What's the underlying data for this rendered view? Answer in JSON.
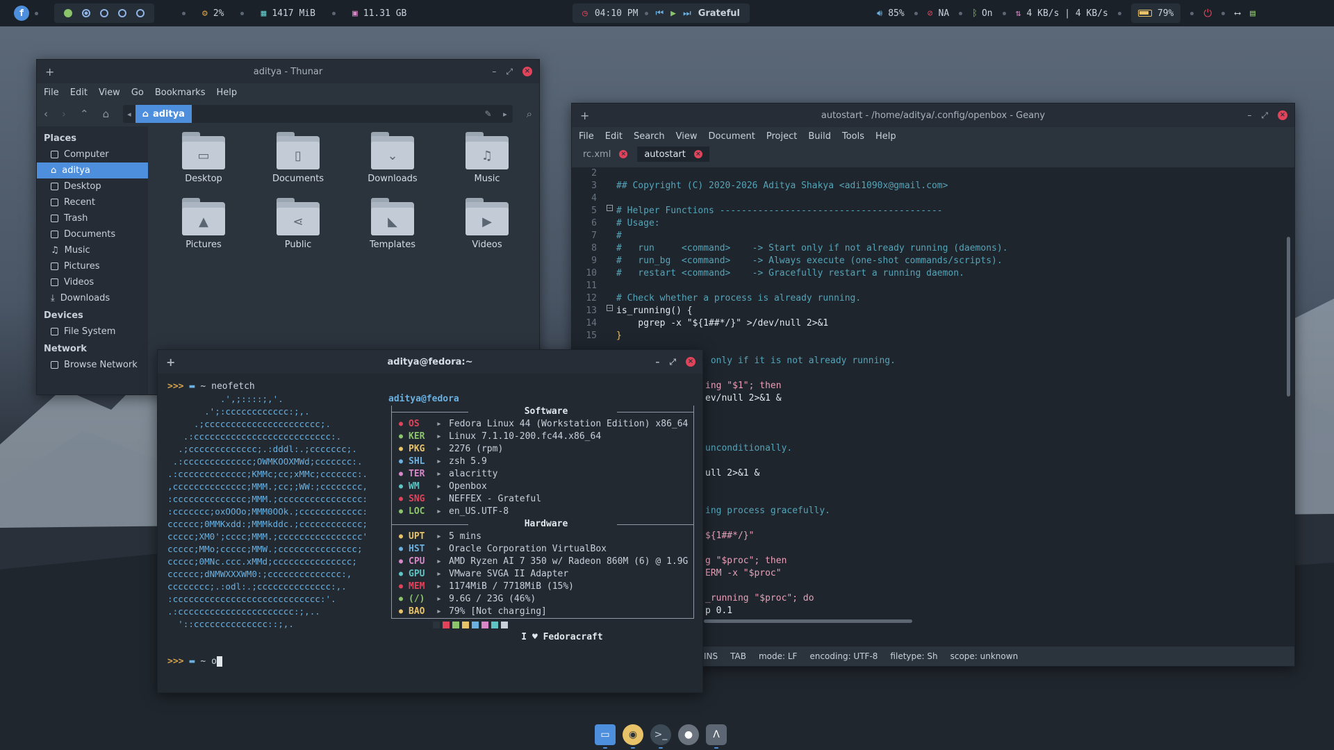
{
  "colors": {
    "accent": "#4d8fdc",
    "close": "#e0435a",
    "bar_bg": "#1b2129",
    "window_bg": "#2b333d"
  },
  "topbar": {
    "cpu": "2%",
    "ram": "1417 MiB",
    "disk": "11.31 GB",
    "clock": "04:10 PM",
    "song": "Grateful",
    "volume": "85%",
    "network": "NA",
    "bluetooth": "On",
    "netspeed": "4 KB/s | 4 KB/s",
    "battery": "79%"
  },
  "thunar": {
    "title": "aditya - Thunar",
    "menu": [
      "File",
      "Edit",
      "View",
      "Go",
      "Bookmarks",
      "Help"
    ],
    "path": "aditya",
    "places_label": "Places",
    "places": [
      "Computer",
      "aditya",
      "Desktop",
      "Recent",
      "Trash",
      "Documents",
      "Music",
      "Pictures",
      "Videos",
      "Downloads"
    ],
    "devices_label": "Devices",
    "devices": [
      "File System"
    ],
    "network_label": "Network",
    "network": [
      "Browse Network"
    ],
    "folders": [
      "Desktop",
      "Documents",
      "Downloads",
      "Music",
      "Pictures",
      "Public",
      "Templates",
      "Videos"
    ]
  },
  "geany": {
    "title": "autostart - /home/aditya/.config/openbox - Geany",
    "menu": [
      "File",
      "Edit",
      "Search",
      "View",
      "Document",
      "Project",
      "Build",
      "Tools",
      "Help"
    ],
    "tabs": [
      "rc.xml",
      "autostart"
    ],
    "line_numbers": [
      "2",
      "3",
      "4",
      "5",
      "6",
      "7",
      "8",
      "9",
      "10",
      "11",
      "12",
      "13",
      "14",
      "15"
    ],
    "code": [
      "",
      "## Copyright (C) 2020-2026 Aditya Shakya <adi1090x@gmail.com>",
      "",
      "# Helper Functions -----------------------------------------",
      "# Usage:",
      "#",
      "#   run     <command>    -> Start only if not already running (daemons).",
      "#   run_bg  <command>    -> Always execute (one-shot commands/scripts).",
      "#   restart <command>    -> Gracefully restart a running daemon.",
      "",
      "# Check whether a process is already running.",
      "is_running() {",
      "    pgrep -x \"${1##*/}\" >/dev/null 2>&1",
      "}"
    ],
    "code_visible": [
      " only if it is not already running.",
      "",
      "ing \"$1\"; then",
      "ev/null 2>&1 &",
      "",
      "",
      "",
      "unconditionally.",
      "",
      "ull 2>&1 &",
      "",
      "",
      "ing process gracefully.",
      "",
      "${1##*/}\"",
      "",
      "g \"$proc\"; then",
      "ERM -x \"$proc\"",
      "",
      "_running \"$proc\"; do",
      "p 0.1"
    ],
    "status": [
      "INS",
      "TAB",
      "mode: LF",
      "encoding: UTF-8",
      "filetype: Sh",
      "scope: unknown"
    ]
  },
  "terminal": {
    "title": "aditya@fedora:~",
    "prompt_arrows": ">>>",
    "prompt_dir": "~",
    "command": "neofetch",
    "typed": "o",
    "logo": [
      "          .',;::::;,'.",
      "       .';:cccccccccccc:;,.",
      "     .;cccccccccccccccccccccc;.",
      "   .:cccccccccccccccccccccccccc:.",
      "  .;ccccccccccccc;.:dddl:.;ccccccc;.",
      " .:ccccccccccccc;OWMKOOXMWd;ccccccc:.",
      ".:ccccccccccccc;KMMc;cc;xMMc;ccccccc:.",
      ",cccccccccccccc;MMM.;cc;;WW:;cccccccc,",
      ":cccccccccccccc;MMM.;cccccccccccccccc:",
      ":ccccccc;oxOOOo;MMM0OOk.;cccccccccccc:",
      "cccccc;0MMKxdd:;MMMkddc.;cccccccccccc;",
      "ccccc;XM0';cccc;MMM.;cccccccccccccccc'",
      "ccccc;MMo;ccccc;MMW.;ccccccccccccccc;",
      "ccccc;0MNc.ccc.xMMd;ccccccccccccccc;",
      "cccccc;dNMWXXXWM0:;cccccccccccccc:,",
      "cccccccc;.:odl:.;cccccccccccccc:,.",
      ":cccccccccccccccccccccccccccc:'.",
      ".:cccccccccccccccccccccc:;,..",
      "  '::cccccccccccccc::;,."
    ],
    "userhost": "aditya@fedora",
    "software_label": "Software",
    "hardware_label": "Hardware",
    "software": [
      {
        "key": "OS",
        "val": "Fedora Linux 44 (Workstation Edition) x86_64",
        "color": "#e0435a"
      },
      {
        "key": "KER",
        "val": "Linux 7.1.10-200.fc44.x86_64",
        "color": "#8bc46a"
      },
      {
        "key": "PKG",
        "val": "2276 (rpm)",
        "color": "#e8c268"
      },
      {
        "key": "SHL",
        "val": "zsh 5.9",
        "color": "#6ab0e0"
      },
      {
        "key": "TER",
        "val": "alacritty",
        "color": "#d787c8"
      },
      {
        "key": "WM",
        "val": "Openbox",
        "color": "#5fc4c4"
      },
      {
        "key": "SNG",
        "val": "NEFFEX - Grateful",
        "color": "#e0435a"
      },
      {
        "key": "LOC",
        "val": "en_US.UTF-8",
        "color": "#8bc46a"
      }
    ],
    "hardware": [
      {
        "key": "UPT",
        "val": "5 mins",
        "color": "#e8c268"
      },
      {
        "key": "HST",
        "val": "Oracle Corporation VirtualBox",
        "color": "#6ab0e0"
      },
      {
        "key": "CPU",
        "val": "AMD Ryzen AI 7 350 w/ Radeon 860M (6) @ 1.9G",
        "color": "#d787c8"
      },
      {
        "key": "GPU",
        "val": "VMware SVGA II Adapter",
        "color": "#5fc4c4"
      },
      {
        "key": "MEM",
        "val": "1174MiB / 7718MiB (15%)",
        "color": "#e0435a"
      },
      {
        "key": "(/)",
        "val": "9.6G / 23G (46%)",
        "color": "#8bc46a"
      },
      {
        "key": "BAO",
        "val": "79% [Not charging]",
        "color": "#e8c268"
      }
    ],
    "swatch_colors": [
      "#2b333d",
      "#e0435a",
      "#8bc46a",
      "#e8c268",
      "#6ab0e0",
      "#d787c8",
      "#5fc4c4",
      "#c8d0da"
    ],
    "love_line": "I ♥ Fedoracraft"
  }
}
